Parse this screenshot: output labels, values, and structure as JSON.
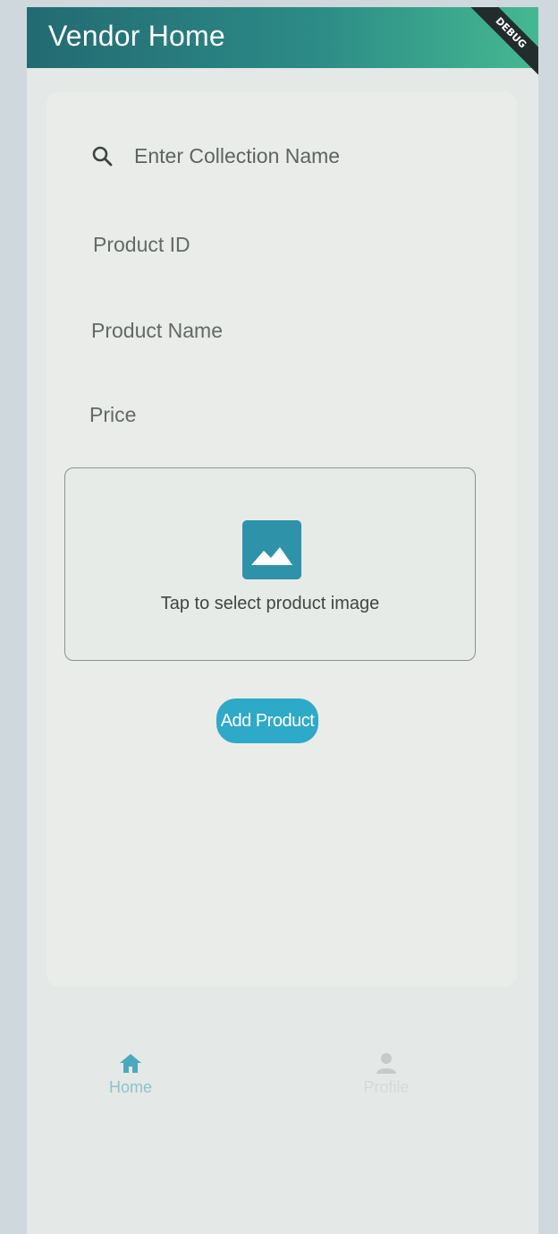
{
  "appbar": {
    "title": "Vendor Home",
    "debug_label": "DEBUG"
  },
  "form": {
    "search_placeholder": "Enter Collection Name",
    "fields": [
      "Product ID",
      "Product Name",
      "Price"
    ],
    "image_picker": {
      "caption": "Tap to select product image",
      "icon": "image-icon"
    },
    "submit_label": "Add Product"
  },
  "bottom_nav": {
    "items": [
      {
        "label": "Home",
        "icon": "home-icon",
        "active": true
      },
      {
        "label": "Profile",
        "icon": "person-icon",
        "active": false
      }
    ]
  },
  "colors": {
    "appbar_start": "#236a72",
    "appbar_end": "#45b891",
    "accent": "#2ea9c8",
    "image_icon": "#2e93a8"
  }
}
